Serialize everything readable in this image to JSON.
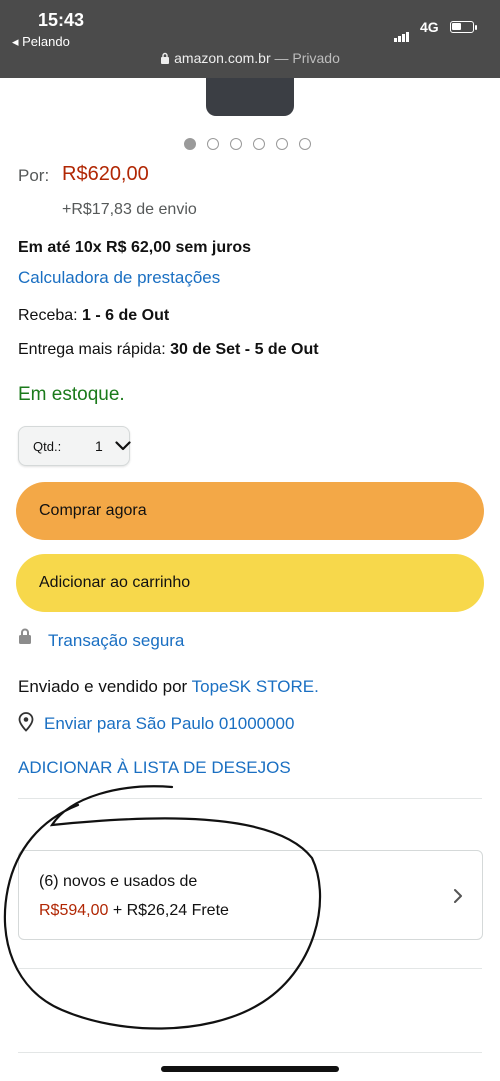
{
  "status_bar": {
    "time": "15:43",
    "back_label": "◂ Pelando",
    "network": "4G",
    "url": "amazon.com.br",
    "url_sep": " — ",
    "private_label": "Privado"
  },
  "carousel": {
    "total": 6,
    "active_index": 0
  },
  "price": {
    "label": "Por:",
    "value": "R$620,00",
    "shipping": "+R$17,83 de envio"
  },
  "installments": {
    "text": "Em até 10x R$ 62,00 sem juros",
    "calculator_link": "Calculadora de prestações"
  },
  "delivery": {
    "receba_label": "Receba:",
    "receba_value": "1 - 6 de Out",
    "fast_label": "Entrega mais rápida:",
    "fast_value": "30 de Set - 5 de Out"
  },
  "stock": "Em estoque.",
  "quantity": {
    "label": "Qtd.:",
    "value": "1"
  },
  "buttons": {
    "buy_now": "Comprar agora",
    "add_to_cart": "Adicionar ao carrinho"
  },
  "secure_transaction": "Transação segura",
  "seller": {
    "prefix": "Enviado e vendido por",
    "name": "TopeSK STORE",
    "suffix": "."
  },
  "ship_to": "Enviar para São Paulo 01000000",
  "wishlist": "ADICIONAR À LISTA DE DESEJOS",
  "offers": {
    "line1": "(6) novos e usados de",
    "price": "R$594,00",
    "freight": " + R$26,24 Frete"
  },
  "colors": {
    "price_red": "#b12704",
    "link_blue": "#1a6fc2",
    "stock_green": "#1b7a1b",
    "buy_orange": "#f3a847",
    "cart_yellow": "#f7d84b"
  }
}
